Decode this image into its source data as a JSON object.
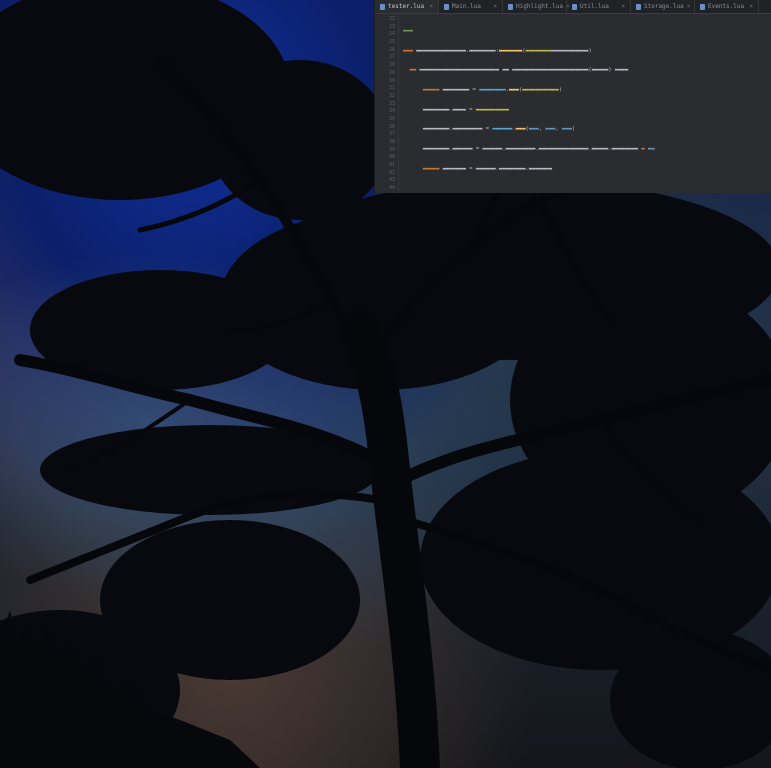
{
  "wallpaper": {
    "description_icon": "tree-silhouette-night-wallpaper",
    "colors": {
      "sky": "#0b1f6a",
      "haze": "#2b4868",
      "silhouette": "#07090e"
    }
  },
  "editor": {
    "tabs": [
      {
        "label": "tester.lua",
        "icon": "file-icon"
      },
      {
        "label": "Main.lua",
        "icon": "file-icon"
      },
      {
        "label": "Highlight.lua",
        "icon": "file-icon"
      },
      {
        "label": "Util.lua",
        "icon": "file-icon"
      },
      {
        "label": "Storage.lua",
        "icon": "file-icon"
      },
      {
        "label": "Events.lua",
        "icon": "file-icon"
      }
    ],
    "line_numbers": [
      "22",
      "23",
      "24",
      "25",
      "26",
      "27",
      "28",
      "29",
      "30",
      "31",
      "32",
      "33",
      "34",
      "35",
      "36",
      "37",
      "38",
      "39",
      "40",
      "41",
      "42",
      "43",
      "44"
    ],
    "colors": {
      "background": "#2a2c30",
      "keyword": "#cc7832",
      "string": "#c4b94a",
      "function": "#ffc66d"
    }
  }
}
